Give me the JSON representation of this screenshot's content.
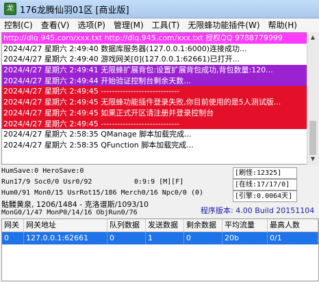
{
  "window": {
    "title": "176龙腾仙羽01区 [商业版]"
  },
  "menu": [
    {
      "label": "控制(C)"
    },
    {
      "label": "查看(V)"
    },
    {
      "label": "选项(P)"
    },
    {
      "label": "管理(M)"
    },
    {
      "label": "工具(T)"
    },
    {
      "label": "无限蜂功能插件(W)"
    },
    {
      "label": "帮助(H)"
    }
  ],
  "log": [
    {
      "style": "magenta",
      "text": "http://dlq.945.com/xxx.txt http://dlq.945.com/xxx.txt 授权QQ 9788779999"
    },
    {
      "style": "plain",
      "text": "2024/4/27 星期六 2:49:40 数据库服务器(127.0.0.1:6000)连接成功..."
    },
    {
      "style": "plain",
      "text": "2024/4/27 星期六 2:49:40 游戏网关[0](127.0.0.1:62661)已打开..."
    },
    {
      "style": "purple",
      "text": "2024/4/27 星期六 2:49:41 无限蜂扩展背包:设置扩展背包成功,背包数量:120..."
    },
    {
      "style": "purple",
      "text": "2024/4/27 星期六 2:49:44 开始验证控制台剩余天数..."
    },
    {
      "style": "red",
      "text": "2024/4/27 星期六 2:49:45 -----------------------------"
    },
    {
      "style": "red",
      "text": "2024/4/27 星期六 2:49:45 无限蜂功能插件登录失败,你目前使用的是5人测试版..."
    },
    {
      "style": "red",
      "text": "2024/4/27 星期六 2:49:45 如果正式开区请注册并登录控制台"
    },
    {
      "style": "red",
      "text": "2024/4/27 星期六 2:49:45 -----------------------------"
    },
    {
      "style": "plain",
      "text": "2024/4/27 星期六 2:58:35 QManage 脚本加载完成..."
    },
    {
      "style": "plain",
      "text": "2024/4/27 星期六 2:58:35 QFunction 脚本加载完成..."
    },
    {
      "style": "plain",
      "text": ""
    }
  ],
  "status": {
    "hum_save": "HumSave:0 HeroSave:0",
    "run": "Run17/9 Soc0/0 Usr0/92",
    "time": "0:9:9 [M][F]",
    "hum": "Hum0/91 Mon0/15 UsrRot15/186 Merch0/16 Npc0/0 (0)",
    "map": "骷髅黄泉, 1206/1484 - 克洛谱斯/1093/10",
    "mon": "MonG0/1/47 MonP0/14/16 ObjRun0/76",
    "refresh": "[刷怪:12325]",
    "online": "[在线:17/17/0]",
    "engine": "[引擎:0.0064天]",
    "version": "程序版本: 4.00 Build 20151104"
  },
  "table": {
    "headers": [
      "网关",
      "网关地址",
      "队列数据",
      "发送数据",
      "剩余数据",
      "平均流量",
      "最高人数"
    ],
    "rows": [
      [
        "0",
        "127.0.0.1:62661",
        "0",
        "1",
        "0",
        "20b",
        "0/1"
      ]
    ]
  }
}
